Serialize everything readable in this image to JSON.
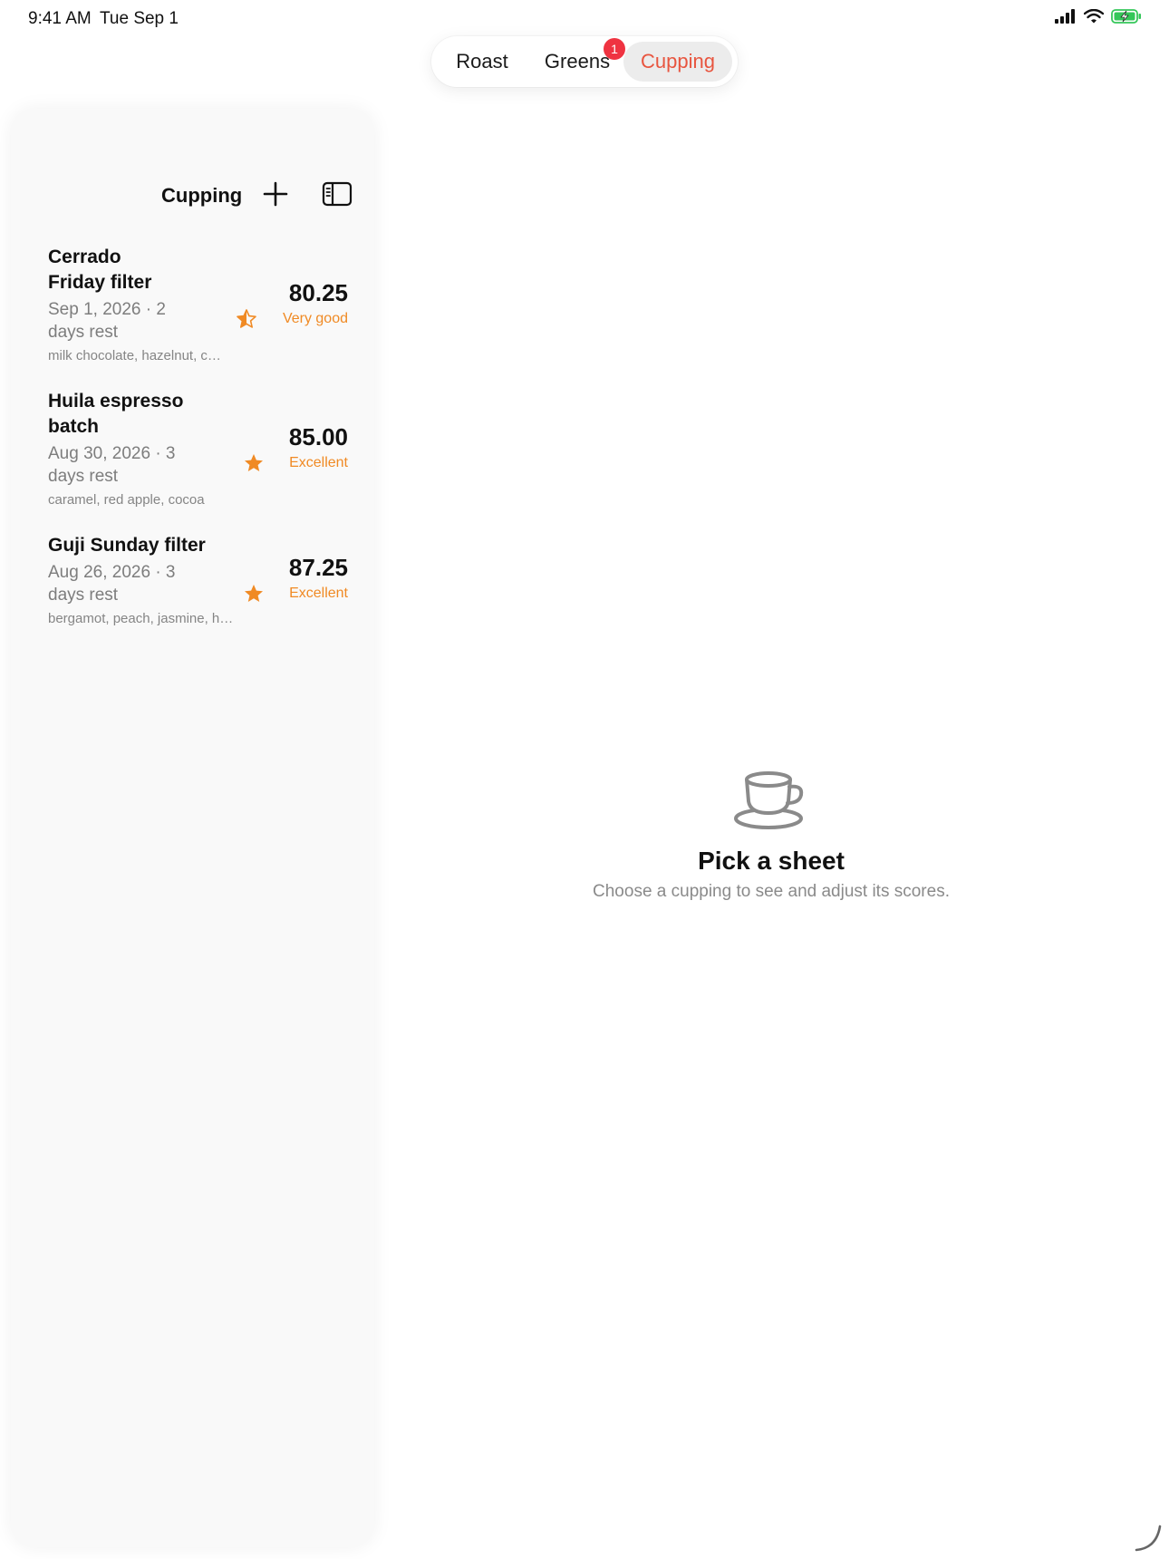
{
  "status_bar": {
    "time": "9:41 AM",
    "date": "Tue Sep 1"
  },
  "tabs": [
    {
      "label": "Roast",
      "selected": false
    },
    {
      "label": "Greens",
      "selected": false,
      "badge": "1"
    },
    {
      "label": "Cupping",
      "selected": true
    }
  ],
  "sidebar": {
    "title": "Cupping",
    "add_icon": "plus-icon",
    "toggle_icon": "sidebar-toggle-icon",
    "items": [
      {
        "title": "Cerrado Friday filter",
        "subtitle": "Sep 1, 2026 · 2 days rest",
        "notes": "milk chocolate, hazelnut, caramel",
        "score": "80.25",
        "rating": "Very good",
        "star": "half-star-icon"
      },
      {
        "title": "Huila espresso batch",
        "subtitle": "Aug 30, 2026 · 3 days rest",
        "notes": "caramel, red apple, cocoa",
        "score": "85.00",
        "rating": "Excellent",
        "star": "star-icon"
      },
      {
        "title": "Guji Sunday filter",
        "subtitle": "Aug 26, 2026 · 3 days rest",
        "notes": "bergamot, peach, jasmine, honey",
        "score": "87.25",
        "rating": "Excellent",
        "star": "star-icon"
      }
    ]
  },
  "detail": {
    "icon": "cup-and-saucer-icon",
    "title": "Pick a sheet",
    "subtitle": "Choose a cupping to see and adjust its scores."
  },
  "colors": {
    "accent": "#e8553f",
    "badge": "#ef3341",
    "rating": "#f08a24",
    "sidebar_bg": "#f9f9f9",
    "tab_selected_bg": "#ececec"
  }
}
